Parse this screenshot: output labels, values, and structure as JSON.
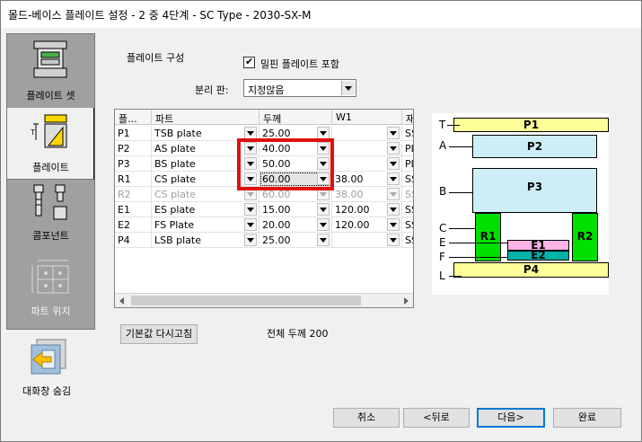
{
  "window": {
    "title": "몰드-베이스 플레이트 설정 - 2 중 4단계   - SC Type - 2030-SX-M"
  },
  "nav": {
    "items": [
      {
        "label": "플레이트 셋",
        "icon": "plate-set-icon"
      },
      {
        "label": "플레이트",
        "icon": "plate-icon"
      },
      {
        "label": "콤포넌트",
        "icon": "component-icon"
      },
      {
        "label": "파트 위치",
        "icon": "part-position-icon"
      }
    ],
    "hide_label": "대화창 숨김"
  },
  "section": {
    "title": "플레이트 구성",
    "checkbox_label": "밀핀 플레이트 포함",
    "checkbox_checked": true,
    "split_label": "분리 판:",
    "split_value": "지정않음"
  },
  "table": {
    "headers": [
      "플...",
      "파트",
      "두께",
      "W1",
      "재"
    ],
    "rows": [
      {
        "id": "P1",
        "part": "TSB plate",
        "thickness": "25.00",
        "w1": "",
        "mat": "SS",
        "disabled": false
      },
      {
        "id": "P2",
        "part": "AS plate",
        "thickness": "40.00",
        "w1": "",
        "mat": "PL",
        "disabled": false
      },
      {
        "id": "P3",
        "part": "BS plate",
        "thickness": "50.00",
        "w1": "",
        "mat": "PL",
        "disabled": false
      },
      {
        "id": "R1",
        "part": "CS plate",
        "thickness": "60.00",
        "w1": "38.00",
        "mat": "SS",
        "disabled": false
      },
      {
        "id": "R2",
        "part": "CS plate",
        "thickness": "60.00",
        "w1": "38.00",
        "mat": "SS",
        "disabled": true
      },
      {
        "id": "E1",
        "part": "ES plate",
        "thickness": "15.00",
        "w1": "120.00",
        "mat": "SS",
        "disabled": false
      },
      {
        "id": "E2",
        "part": "FS Plate",
        "thickness": "20.00",
        "w1": "120.00",
        "mat": "SS",
        "disabled": false
      },
      {
        "id": "P4",
        "part": "LSB plate",
        "thickness": "25.00",
        "w1": "",
        "mat": "SS",
        "disabled": false
      }
    ]
  },
  "reset_button": "기본값 다시고침",
  "total_thickness": "전체 두께 200",
  "footer": {
    "cancel": "취소",
    "back": "<뒤로",
    "next": "다음>",
    "finish": "완료"
  },
  "diagram": {
    "plates": [
      "P1",
      "P2",
      "P3",
      "R1",
      "R2",
      "E1",
      "E2",
      "P4"
    ],
    "labels": [
      "T",
      "A",
      "B",
      "C",
      "E",
      "F",
      "L"
    ]
  },
  "colors": {
    "plate_blue": "#cdeef7",
    "plate_yellow": "#ffff99",
    "plate_green": "#00e000",
    "plate_pink": "#ffb3e6",
    "plate_teal": "#00b3a6",
    "highlight_red": "#e01010"
  }
}
